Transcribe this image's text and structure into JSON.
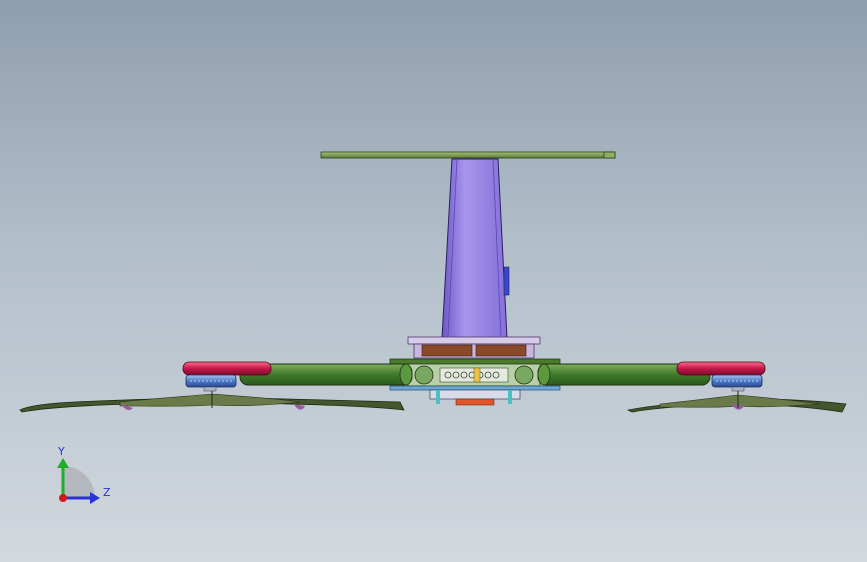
{
  "viewport": {
    "background_top": "#8f9eaf",
    "background_bottom": "#d2d8de"
  },
  "model": {
    "view": "front",
    "parts": [
      "top-plate",
      "mast",
      "center-hub",
      "arm-left",
      "arm-right",
      "motor-left",
      "motor-right",
      "propeller-left",
      "propeller-right"
    ],
    "colors": {
      "plate": "#6f8f4a",
      "mast": "#9b86e6",
      "arm": "#3f7a2c",
      "motor_red": "#c2184a",
      "motor_blue": "#4a78c8",
      "blade": "#45562e",
      "blade_tip": "#8a4a8e"
    }
  },
  "triad": {
    "y_label": "Y",
    "z_label": "Z",
    "y_color": "#1fae2a",
    "z_color": "#2a34d6",
    "origin_color": "#d11a1a"
  }
}
